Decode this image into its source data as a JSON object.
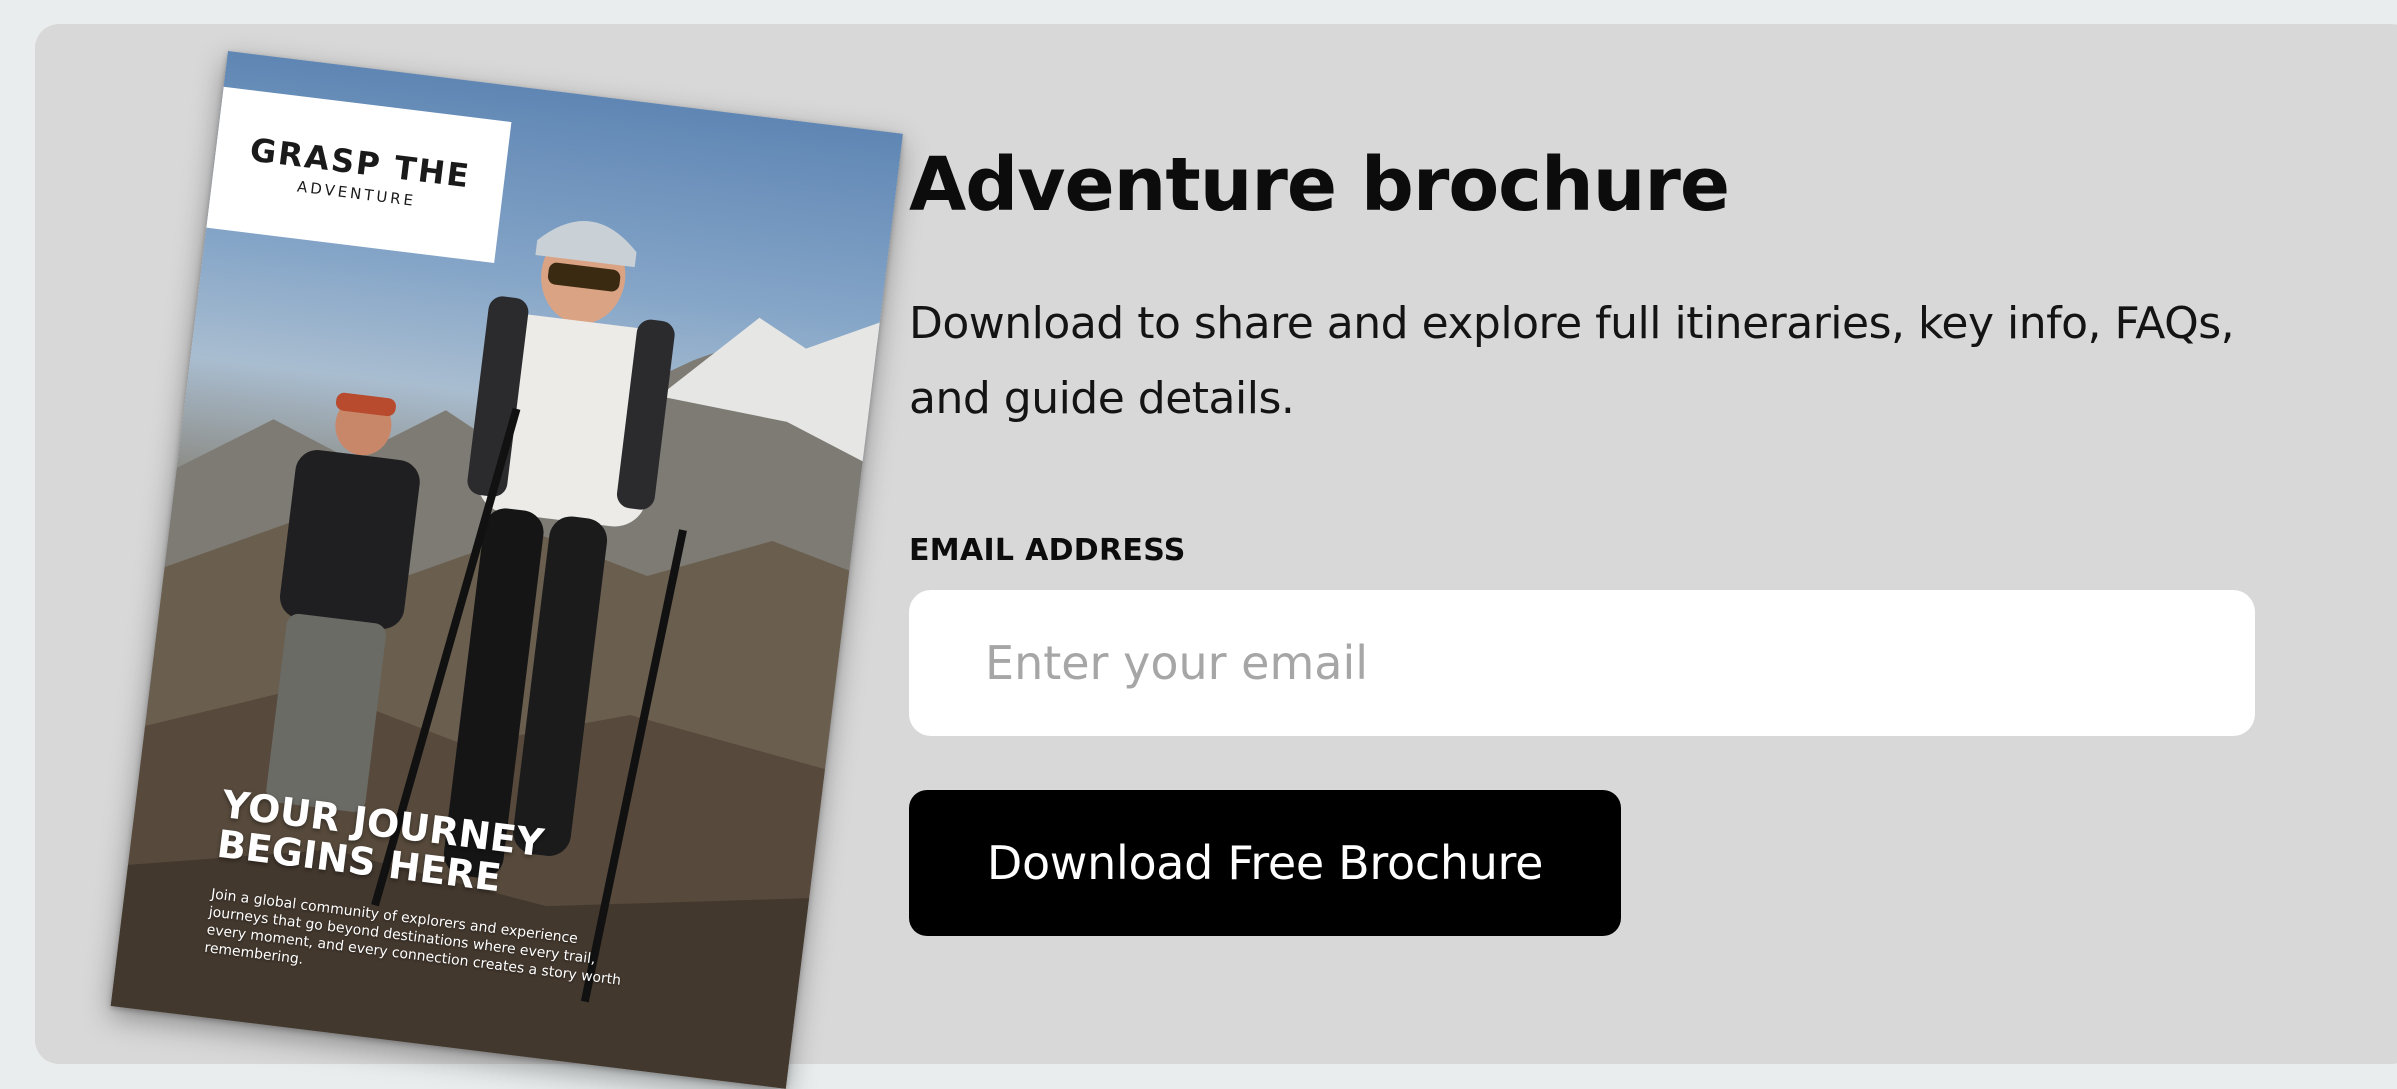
{
  "brochure": {
    "logo_main": "GRASP THE",
    "logo_sub": "ADVENTURE",
    "tagline": "YOUR JOURNEY\nBEGINS HERE",
    "blurb": "Join a global community of explorers and experience journeys that go beyond destinations where every trail, every moment, and every connection creates a story worth remembering."
  },
  "signup": {
    "title": "Adventure brochure",
    "description": "Download to share and explore full itineraries, key info, FAQs, and guide details.",
    "email_label": "EMAIL ADDRESS",
    "email_placeholder": "Enter your email",
    "email_value": "",
    "button_label": "Download Free Brochure"
  },
  "colors": {
    "card_background": "#d8d8d8",
    "page_background": "#e9eded",
    "button_background": "#000000",
    "button_text": "#ffffff"
  }
}
